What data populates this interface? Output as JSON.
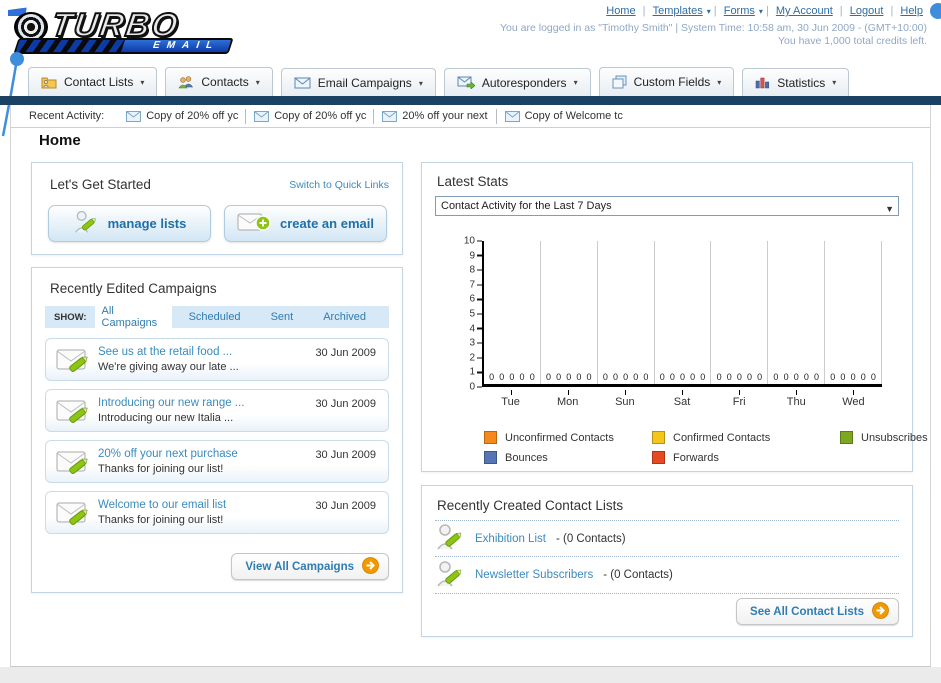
{
  "brand": {
    "name_top": "TURBO",
    "name_bottom": "EMAIL"
  },
  "top_nav": {
    "links": [
      {
        "label": "Home",
        "dropdown": false
      },
      {
        "label": "Templates",
        "dropdown": true
      },
      {
        "label": "Forms",
        "dropdown": true
      },
      {
        "label": "My Account",
        "dropdown": false
      },
      {
        "label": "Logout",
        "dropdown": false
      },
      {
        "label": "Help",
        "dropdown": false
      }
    ]
  },
  "login_info": {
    "line1": "You are logged in as \"Timothy Smith\" | System Time: 10:58 am, 30 Jun 2009 - (GMT+10:00)",
    "line2": "You have 1,000 total credits left."
  },
  "main_nav": {
    "tabs": [
      {
        "label": "Contact Lists",
        "icon": "contact-lists-icon"
      },
      {
        "label": "Contacts",
        "icon": "contacts-icon"
      },
      {
        "label": "Email Campaigns",
        "icon": "email-campaigns-icon"
      },
      {
        "label": "Autoresponders",
        "icon": "autoresponders-icon"
      },
      {
        "label": "Custom Fields",
        "icon": "custom-fields-icon"
      },
      {
        "label": "Statistics",
        "icon": "statistics-icon"
      }
    ]
  },
  "recent_activity": {
    "label": "Recent Activity:",
    "items": [
      "Copy of 20% off yc",
      "Copy of 20% off yc",
      "20% off your next ",
      "Copy of Welcome tc"
    ]
  },
  "page_title": "Home",
  "get_started": {
    "title": "Let's Get Started",
    "switch_link": "Switch to Quick Links",
    "buttons": [
      {
        "label": "manage lists",
        "icon": "manage-lists-icon"
      },
      {
        "label": "create an email",
        "icon": "create-email-icon"
      }
    ]
  },
  "campaigns": {
    "title": "Recently Edited Campaigns",
    "show_label": "SHOW:",
    "filters": [
      {
        "label": "All Campaigns",
        "active": true
      },
      {
        "label": "Scheduled",
        "active": false
      },
      {
        "label": "Sent",
        "active": false
      },
      {
        "label": "Archived",
        "active": false
      }
    ],
    "items": [
      {
        "title": "See us at the retail food ...",
        "subtitle": "We're giving away our late ...",
        "date": "30 Jun 2009"
      },
      {
        "title": "Introducing our new range ...",
        "subtitle": "Introducing our new Italia ...",
        "date": "30 Jun 2009"
      },
      {
        "title": "20% off your next purchase",
        "subtitle": "Thanks for joining our list!",
        "date": "30 Jun 2009"
      },
      {
        "title": "Welcome to our email list",
        "subtitle": "Thanks for joining our list!",
        "date": "30 Jun 2009"
      }
    ],
    "view_all_label": "View All Campaigns"
  },
  "latest_stats": {
    "title": "Latest Stats",
    "dropdown_value": "Contact Activity for the Last 7 Days"
  },
  "chart_data": {
    "type": "bar",
    "title": "Contact Activity for the Last 7 Days",
    "categories": [
      "Tue",
      "Mon",
      "Sun",
      "Sat",
      "Fri",
      "Thu",
      "Wed"
    ],
    "series": [
      {
        "name": "Unconfirmed Contacts",
        "color": "#f6891e",
        "values": [
          0,
          0,
          0,
          0,
          0,
          0,
          0
        ]
      },
      {
        "name": "Confirmed Contacts",
        "color": "#f3c51d",
        "values": [
          0,
          0,
          0,
          0,
          0,
          0,
          0
        ]
      },
      {
        "name": "Unsubscribes",
        "color": "#7da621",
        "values": [
          0,
          0,
          0,
          0,
          0,
          0,
          0
        ]
      },
      {
        "name": "Bounces",
        "color": "#5575b4",
        "values": [
          0,
          0,
          0,
          0,
          0,
          0,
          0
        ]
      },
      {
        "name": "Forwards",
        "color": "#e64a22",
        "values": [
          0,
          0,
          0,
          0,
          0,
          0,
          0
        ]
      }
    ],
    "ylim": [
      0,
      10
    ],
    "yticks": [
      0,
      1,
      2,
      3,
      4,
      5,
      6,
      7,
      8,
      9,
      10
    ],
    "grid": "vertical-between-groups",
    "legend_position": "bottom"
  },
  "contact_lists": {
    "title": "Recently Created Contact Lists",
    "items": [
      {
        "name": "Exhibition List",
        "count_text": "- (0 Contacts)"
      },
      {
        "name": "Newsletter Subscribers",
        "count_text": "- (0 Contacts)"
      }
    ],
    "see_all_label": "See All Contact Lists"
  },
  "colors": {
    "navy_bar": "#1b4263",
    "link_blue": "#2e6da4",
    "panel_link_blue": "#3a8bbe",
    "filter_bar_bg": "#d7e9f7",
    "accent_orange": "#f09a00"
  }
}
